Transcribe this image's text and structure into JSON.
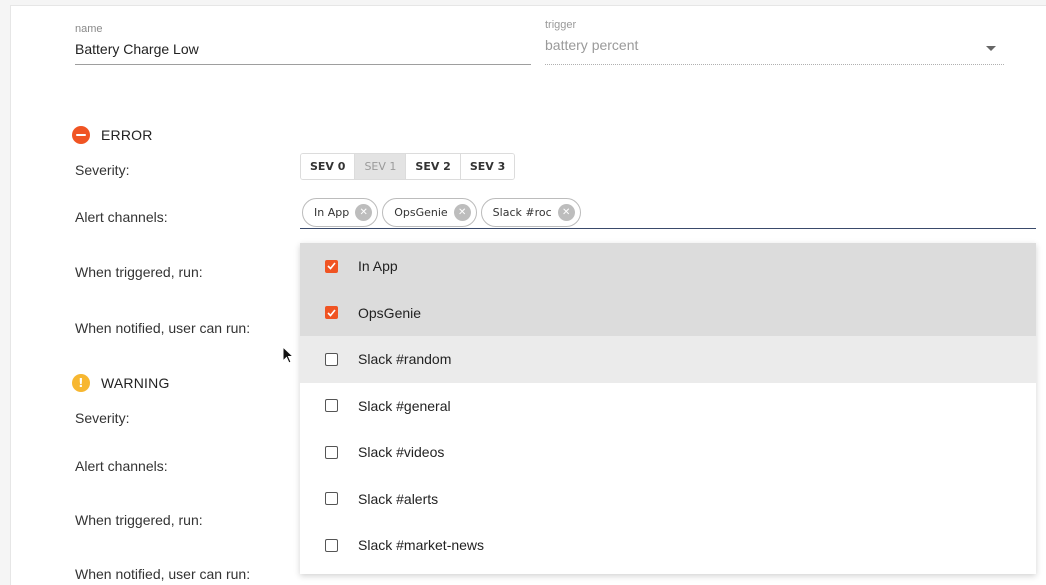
{
  "fields": {
    "name": {
      "label": "name",
      "value": "Battery Charge Low"
    },
    "trigger": {
      "label": "trigger",
      "value": "battery percent"
    }
  },
  "sections": {
    "error": {
      "title": "ERROR",
      "icon": "minus-circle-icon",
      "color": "#f05423",
      "severity_label": "Severity:",
      "alert_channels_label": "Alert channels:",
      "when_triggered_label": "When triggered, run:",
      "when_notified_label": "When notified, user can run:"
    },
    "warning": {
      "title": "WARNING",
      "icon": "exclamation-circle-icon",
      "color": "#f7b731",
      "severity_label": "Severity:",
      "alert_channels_label": "Alert channels:",
      "when_triggered_label": "When triggered, run:",
      "when_notified_label": "When notified, user can run:"
    }
  },
  "severity": {
    "options": [
      "SEV 0",
      "SEV 1",
      "SEV 2",
      "SEV 3"
    ],
    "selected": "SEV 1"
  },
  "chips": [
    "In App",
    "OpsGenie",
    "Slack #roc"
  ],
  "dropdown": {
    "options": [
      {
        "label": "In App",
        "checked": true
      },
      {
        "label": "OpsGenie",
        "checked": true
      },
      {
        "label": "Slack #random",
        "checked": false,
        "hover": true
      },
      {
        "label": "Slack #general",
        "checked": false
      },
      {
        "label": "Slack #videos",
        "checked": false
      },
      {
        "label": "Slack #alerts",
        "checked": false
      },
      {
        "label": "Slack #market-news",
        "checked": false
      }
    ]
  },
  "colors": {
    "accent": "#f05423",
    "warning": "#f7b731",
    "underline": "#3a4a6b"
  }
}
